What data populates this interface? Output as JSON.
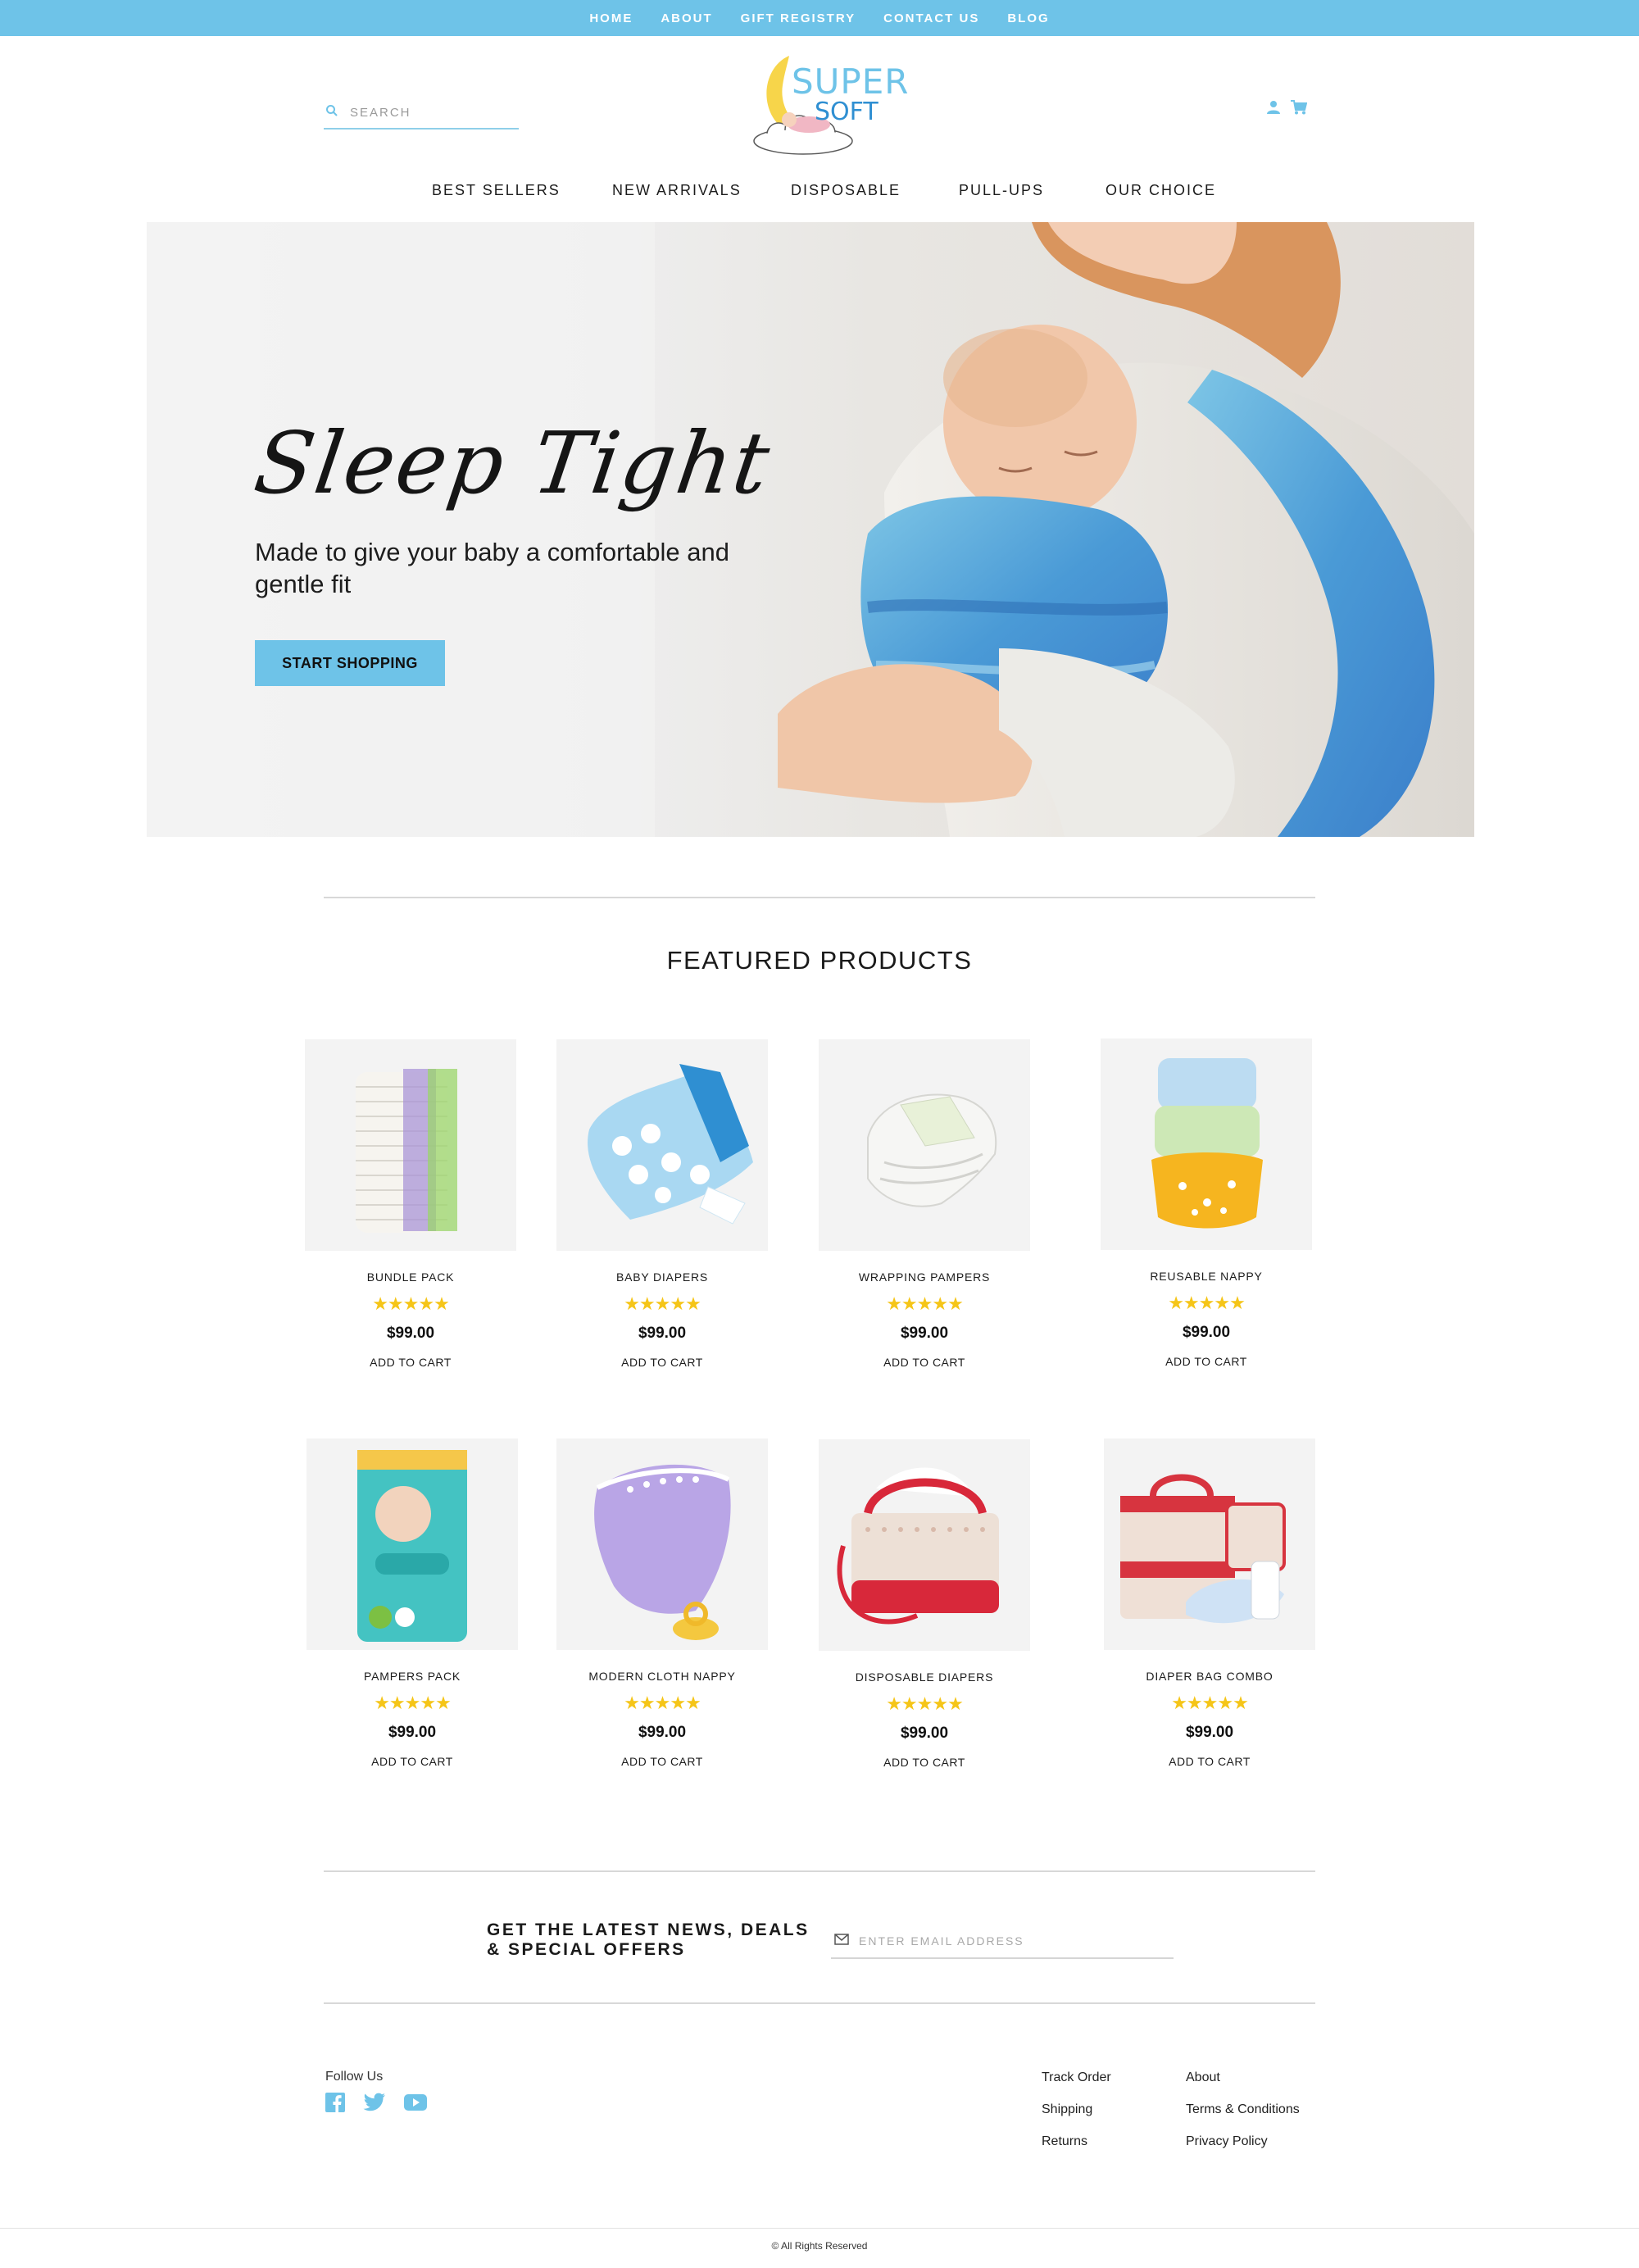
{
  "topnav": [
    "HOME",
    "ABOUT",
    "GIFT REGISTRY",
    "CONTACT US",
    "BLOG"
  ],
  "search": {
    "placeholder": "SEARCH"
  },
  "logo": {
    "line1": "SUPER",
    "line2": "SOFT"
  },
  "mainnav": [
    "BEST SELLERS",
    "NEW ARRIVALS",
    "DISPOSABLE",
    "PULL-UPS",
    "OUR CHOICE"
  ],
  "hero": {
    "title": "Sleep Tight",
    "subtitle": "Made to give your baby a comfortable and gentle fit",
    "button": "START SHOPPING"
  },
  "featured": {
    "title": "FEATURED PRODUCTS",
    "rating_stars": "★★★★★",
    "add_to_cart": "ADD TO CART",
    "products": [
      {
        "name": "BUNDLE PACK",
        "price": "$99.00"
      },
      {
        "name": "BABY DIAPERS",
        "price": "$99.00"
      },
      {
        "name": "WRAPPING PAMPERS",
        "price": "$99.00"
      },
      {
        "name": "REUSABLE NAPPY",
        "price": "$99.00"
      },
      {
        "name": "PAMPERS PACK",
        "price": "$99.00"
      },
      {
        "name": "MODERN CLOTH NAPPY",
        "price": "$99.00"
      },
      {
        "name": "DISPOSABLE DIAPERS",
        "price": "$99.00"
      },
      {
        "name": "DIAPER BAG COMBO",
        "price": "$99.00"
      }
    ]
  },
  "newsletter": {
    "title": "GET THE LATEST NEWS, DEALS & SPECIAL OFFERS",
    "placeholder": "ENTER EMAIL ADDRESS"
  },
  "footer": {
    "follow_label": "Follow Us",
    "social_icons": [
      "facebook-icon",
      "twitter-icon",
      "youtube-icon"
    ],
    "col1": [
      "Track Order",
      "Shipping",
      "Returns"
    ],
    "col2": [
      "About",
      "Terms & Conditions",
      "Privacy Policy"
    ],
    "copyright": "© All Rights Reserved"
  },
  "colors": {
    "accent": "#6ec3e8",
    "star": "#f5c518"
  }
}
